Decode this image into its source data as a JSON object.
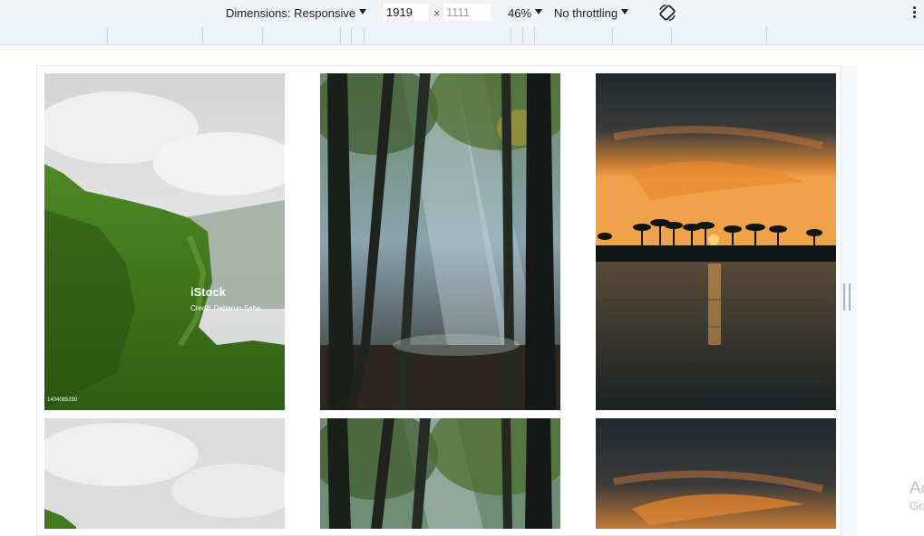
{
  "toolbar": {
    "dimensions_label": "Dimensions: Responsive",
    "width_value": "1919",
    "times_sign": "×",
    "height_placeholder": "1111",
    "zoom_label": "46%",
    "throttling_label": "No throttling",
    "rotate_icon": "rotate-icon",
    "more_icon": "more-vert-icon"
  },
  "gallery": {
    "images": [
      {
        "subject": "green-cliff-misty-sky",
        "stock_brand": "iStock",
        "stock_credit": "Credit: Debarun Saha",
        "stock_id": "1404085250"
      },
      {
        "subject": "forest-sun-rays"
      },
      {
        "subject": "palm-sunset-lake"
      },
      {
        "subject": "green-cliff-misty-sky"
      },
      {
        "subject": "forest-sun-rays"
      },
      {
        "subject": "palm-sunset-lake"
      }
    ]
  },
  "watermark": {
    "line1": "Ac",
    "line2": "Go"
  },
  "colors": {
    "toolbar_bg": "#f1f3f4",
    "ruler_bg": "#edf2fc",
    "sky_grey": "#d9d9d9",
    "cliff_green": "#3f7a1c",
    "forest_dark": "#1d2522",
    "sunset_orange": "#e8892f"
  }
}
